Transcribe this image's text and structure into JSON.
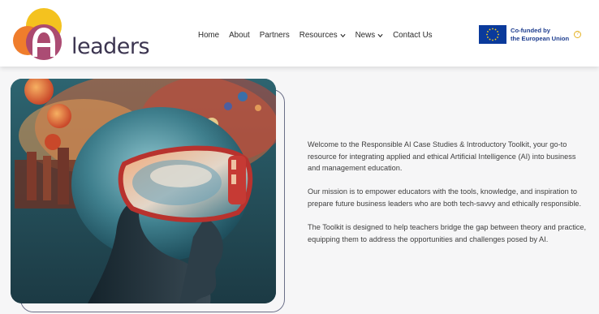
{
  "brand": {
    "logo_text": "leaders",
    "logo_colors": {
      "yellow": "#f4c21f",
      "orange": "#ef7d2c",
      "red": "#e2463c",
      "purple": "#7d4a9b",
      "dark": "#3c3550"
    }
  },
  "nav": {
    "items": [
      {
        "label": "Home",
        "has_dropdown": false
      },
      {
        "label": "About",
        "has_dropdown": false
      },
      {
        "label": "Partners",
        "has_dropdown": false
      },
      {
        "label": "Resources",
        "has_dropdown": true
      },
      {
        "label": "News",
        "has_dropdown": true
      },
      {
        "label": "Contact Us",
        "has_dropdown": false
      }
    ]
  },
  "eu_badge": {
    "line1": "Co-funded by",
    "line2": "the European Union",
    "flag_color": "#0a3a9b",
    "star_color": "#ffd617"
  },
  "hero": {
    "icon": "vr-headset-person-illustration"
  },
  "content": {
    "paragraphs": [
      "Welcome to the Responsible AI Case Studies & Introductory Toolkit, your go-to resource for integrating applied and ethical Artificial Intelligence (AI) into business and management education.",
      "Our mission is to empower educators with the tools, knowledge, and inspiration to prepare future business leaders who are both tech-savvy and ethically responsible.",
      "The Toolkit is designed to help teachers bridge the gap between theory and practice, equipping them to address the opportunities and challenges posed by AI."
    ]
  }
}
